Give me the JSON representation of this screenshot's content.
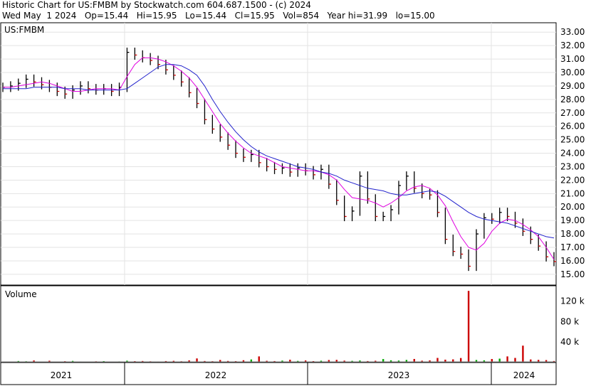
{
  "header": {
    "line1": "Historic Chart for US:FMBM by Stockwatch.com 604.687.1500 - (c) 2024",
    "line2": "Wed May  1 2024   Op=15.44   Hi=15.95   Lo=15.44   Cl=15.95   Vol=854   Year hi=31.99   lo=15.00"
  },
  "chart_data": {
    "type": "line",
    "symbol_label": "US:FMBM",
    "price_axis": {
      "ticks": [
        "33.00",
        "32.00",
        "31.00",
        "30.00",
        "29.00",
        "28.00",
        "27.00",
        "26.00",
        "25.00",
        "24.00",
        "23.00",
        "22.00",
        "21.00",
        "20.00",
        "19.00",
        "18.00",
        "17.00",
        "16.00",
        "15.00"
      ],
      "ylim": [
        14.2,
        33.7
      ]
    },
    "volume_label": "Volume",
    "volume_axis": {
      "ticks": [
        "120 k",
        "80 k",
        "40 k"
      ],
      "ylim": [
        0,
        150000
      ]
    },
    "x_axis": {
      "labels": [
        "2021",
        "2022",
        "2023",
        "2024"
      ]
    },
    "series": [
      {
        "values": [
          28.9,
          29.0,
          29.2,
          29.5,
          29.3,
          29.1,
          28.9,
          28.6,
          28.4,
          28.7,
          29.0,
          28.8,
          28.7,
          28.8,
          28.6,
          28.9,
          31.5,
          31.3,
          31.1,
          30.9,
          30.6,
          30.2,
          29.8,
          29.3,
          28.5,
          27.7,
          26.5,
          25.8,
          25.2,
          24.6,
          24.0,
          23.7,
          23.9,
          23.3,
          23.0,
          22.8,
          22.9,
          22.6,
          22.9,
          22.7,
          22.4,
          22.8,
          21.7,
          20.5,
          19.3,
          19.7,
          22.3,
          20.6,
          19.3,
          19.3,
          19.8,
          21.6,
          22.3,
          21.4,
          21.0,
          20.9,
          19.6,
          17.6,
          16.7,
          16.5,
          15.6,
          18.0,
          19.2,
          19.1,
          19.6,
          19.3,
          18.8,
          18.2,
          17.6,
          17.1,
          16.3,
          15.95
        ]
      },
      {
        "values": [
          28.9,
          28.9,
          29.0,
          29.1,
          29.2,
          29.3,
          29.2,
          29.0,
          28.8,
          28.6,
          28.6,
          28.7,
          28.8,
          28.8,
          28.8,
          28.7,
          29.7,
          30.6,
          31.1,
          31.1,
          31.0,
          30.8,
          30.5,
          30.1,
          29.6,
          28.9,
          28.0,
          27.1,
          26.2,
          25.5,
          24.9,
          24.4,
          24.0,
          23.8,
          23.6,
          23.3,
          23.0,
          22.9,
          22.8,
          22.7,
          22.7,
          22.6,
          22.4,
          22.0,
          21.3,
          20.7,
          20.6,
          20.5,
          20.3,
          20.0,
          20.3,
          20.7,
          21.2,
          21.5,
          21.6,
          21.4,
          20.9,
          20.1,
          18.9,
          17.8,
          17.0,
          16.8,
          17.3,
          18.2,
          18.8,
          19.1,
          19.0,
          18.7,
          18.3,
          17.8,
          17.0,
          16.1
        ]
      },
      {
        "values": [
          28.8,
          28.8,
          28.8,
          28.8,
          28.9,
          28.9,
          28.9,
          28.9,
          28.8,
          28.8,
          28.8,
          28.7,
          28.7,
          28.7,
          28.7,
          28.7,
          28.8,
          29.2,
          29.6,
          30.0,
          30.4,
          30.6,
          30.6,
          30.5,
          30.2,
          29.8,
          29.0,
          28.0,
          27.1,
          26.3,
          25.6,
          25.0,
          24.5,
          24.1,
          23.8,
          23.6,
          23.4,
          23.2,
          23.0,
          22.9,
          22.8,
          22.6,
          22.5,
          22.3,
          22.0,
          21.8,
          21.6,
          21.4,
          21.3,
          21.2,
          21.0,
          20.9,
          20.9,
          21.0,
          21.1,
          21.2,
          21.1,
          20.8,
          20.4,
          20.0,
          19.6,
          19.3,
          19.1,
          19.0,
          18.9,
          18.8,
          18.6,
          18.4,
          18.2,
          18.0,
          17.8,
          17.7
        ]
      }
    ],
    "volume": {
      "values": [
        2000,
        1500,
        3000,
        2500,
        4000,
        2000,
        3500,
        1800,
        2600,
        3200,
        2100,
        1700,
        2400,
        2800,
        1900,
        2200,
        3600,
        2700,
        3000,
        2400,
        2100,
        2900,
        3300,
        2500,
        4200,
        8000,
        3000,
        2600,
        5000,
        3100,
        2700,
        4500,
        6000,
        12000,
        3400,
        2900,
        3800,
        5500,
        3200,
        4100,
        2800,
        3600,
        4900,
        5200,
        3700,
        3300,
        4000,
        2900,
        3500,
        6800,
        4400,
        3900,
        5100,
        7000,
        3600,
        4200,
        9000,
        5600,
        6200,
        8800,
        140000,
        5000,
        4300,
        6900,
        7600,
        12000,
        9000,
        33000,
        6000,
        5200,
        4800,
        3000
      ]
    },
    "colors": {
      "candle": "#000000",
      "down_candle": "#cc0000",
      "ma_short": "#e000e0",
      "ma_long": "#2222cc",
      "vol_up": "#00aa00",
      "vol_down": "#cc0000"
    }
  }
}
